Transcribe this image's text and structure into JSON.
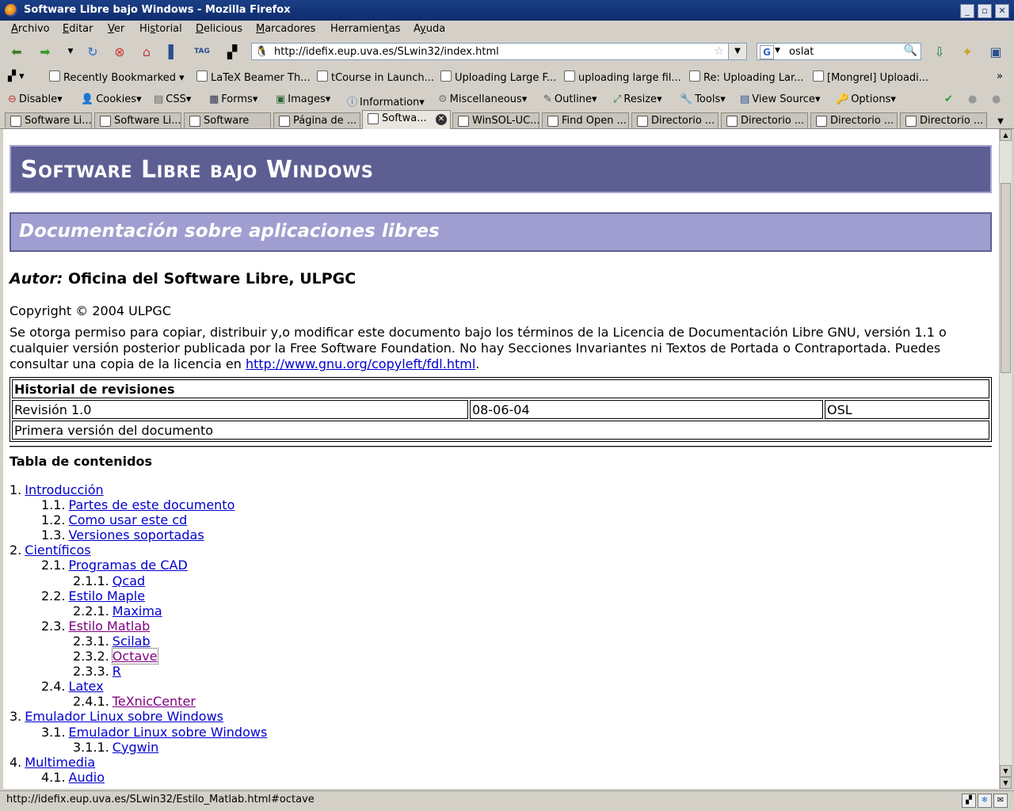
{
  "window": {
    "title": "Software Libre bajo Windows - Mozilla Firefox"
  },
  "menu": [
    {
      "pre": "",
      "u": "A",
      "post": "rchivo"
    },
    {
      "pre": "",
      "u": "E",
      "post": "ditar"
    },
    {
      "pre": "",
      "u": "V",
      "post": "er"
    },
    {
      "pre": "Hi",
      "u": "s",
      "post": "torial"
    },
    {
      "pre": "",
      "u": "D",
      "post": "elicious"
    },
    {
      "pre": "",
      "u": "M",
      "post": "arcadores"
    },
    {
      "pre": "Herramien",
      "u": "t",
      "post": "as"
    },
    {
      "pre": "A",
      "u": "y",
      "post": "uda"
    }
  ],
  "nav": {
    "url": "http://idefix.eup.uva.es/SLwin32/index.html",
    "search_value": "oslat",
    "search_engine": "G"
  },
  "bookmarks": [
    "Recently Bookmarked",
    "LaTeX Beamer Th...",
    "tCourse in Launch...",
    "Uploading Large F...",
    "uploading large fil...",
    "Re: Uploading Lar...",
    "[Mongrel] Uploadi..."
  ],
  "devtoolbar": [
    "Disable",
    "Cookies",
    "CSS",
    "Forms",
    "Images",
    "Information",
    "Miscellaneous",
    "Outline",
    "Resize",
    "Tools",
    "View Source",
    "Options"
  ],
  "tabs": [
    "Software Li...",
    "Software Li...",
    "Software",
    "Página de ...",
    "Softwa...",
    "WinSOL-UC...",
    "Find Open ...",
    "Directorio ...",
    "Directorio ...",
    "Directorio ...",
    "Directorio ..."
  ],
  "page": {
    "h1": "Software Libre bajo Windows",
    "h2": "Documentación sobre aplicaciones libres",
    "author_label": "Autor:",
    "author_name": "Oficina del Software Libre, ULPGC",
    "copyright": "Copyright © 2004 ULPGC",
    "permission_text": "Se otorga permiso para copiar, distribuir y,o modificar este documento bajo los términos de la Licencia de Documentación Libre GNU, versión 1.1 o cualquier versión posterior publicada por la Free Software Foundation. No hay Secciones Invariantes ni Textos de Portada o Contraportada. Puedes consultar una copia de la licencia en ",
    "license_link": "http://www.gnu.org/copyleft/fdl.html",
    "period": ".",
    "revision_header": "Historial de revisiones",
    "revision": "Revisión 1.0",
    "revision_date": "08-06-04",
    "revision_author": "OSL",
    "revision_note": "Primera versión del documento",
    "toc_title": "Tabla de contenidos",
    "toc": [
      {
        "n": "1.",
        "t": "Introducción",
        "lvl": 1
      },
      {
        "n": "1.1.",
        "t": "Partes de este documento",
        "lvl": 2
      },
      {
        "n": "1.2.",
        "t": "Como usar este cd",
        "lvl": 2
      },
      {
        "n": "1.3.",
        "t": "Versiones soportadas",
        "lvl": 2
      },
      {
        "n": "2.",
        "t": "Científicos",
        "lvl": 1
      },
      {
        "n": "2.1.",
        "t": "Programas de CAD",
        "lvl": 2
      },
      {
        "n": "2.1.1.",
        "t": "Qcad",
        "lvl": 3
      },
      {
        "n": "2.2.",
        "t": "Estilo Maple",
        "lvl": 2
      },
      {
        "n": "2.2.1.",
        "t": "Maxima",
        "lvl": 3
      },
      {
        "n": "2.3.",
        "t": "Estilo Matlab",
        "lvl": 2,
        "visited": true
      },
      {
        "n": "2.3.1.",
        "t": "Scilab",
        "lvl": 3
      },
      {
        "n": "2.3.2.",
        "t": "Octave",
        "lvl": 3,
        "visited": true,
        "focused": true
      },
      {
        "n": "2.3.3.",
        "t": "R",
        "lvl": 3
      },
      {
        "n": "2.4.",
        "t": "Latex",
        "lvl": 2
      },
      {
        "n": "2.4.1.",
        "t": "TeXnicCenter",
        "lvl": 3,
        "visited": true
      },
      {
        "n": "3.",
        "t": "Emulador Linux sobre Windows",
        "lvl": 1
      },
      {
        "n": "3.1.",
        "t": "Emulador Linux sobre Windows",
        "lvl": 2
      },
      {
        "n": "3.1.1.",
        "t": "Cygwin",
        "lvl": 3
      },
      {
        "n": "4.",
        "t": "Multimedia",
        "lvl": 1
      },
      {
        "n": "4.1.",
        "t": "Audio",
        "lvl": 2
      }
    ]
  },
  "status": {
    "text": "http://idefix.eup.uva.es/SLwin32/Estilo_Matlab.html#octave"
  },
  "colors": {
    "h1_bg": "#5d5f93",
    "h2_bg": "#a09ed0",
    "link": "#0000cc",
    "visited": "#800080"
  }
}
